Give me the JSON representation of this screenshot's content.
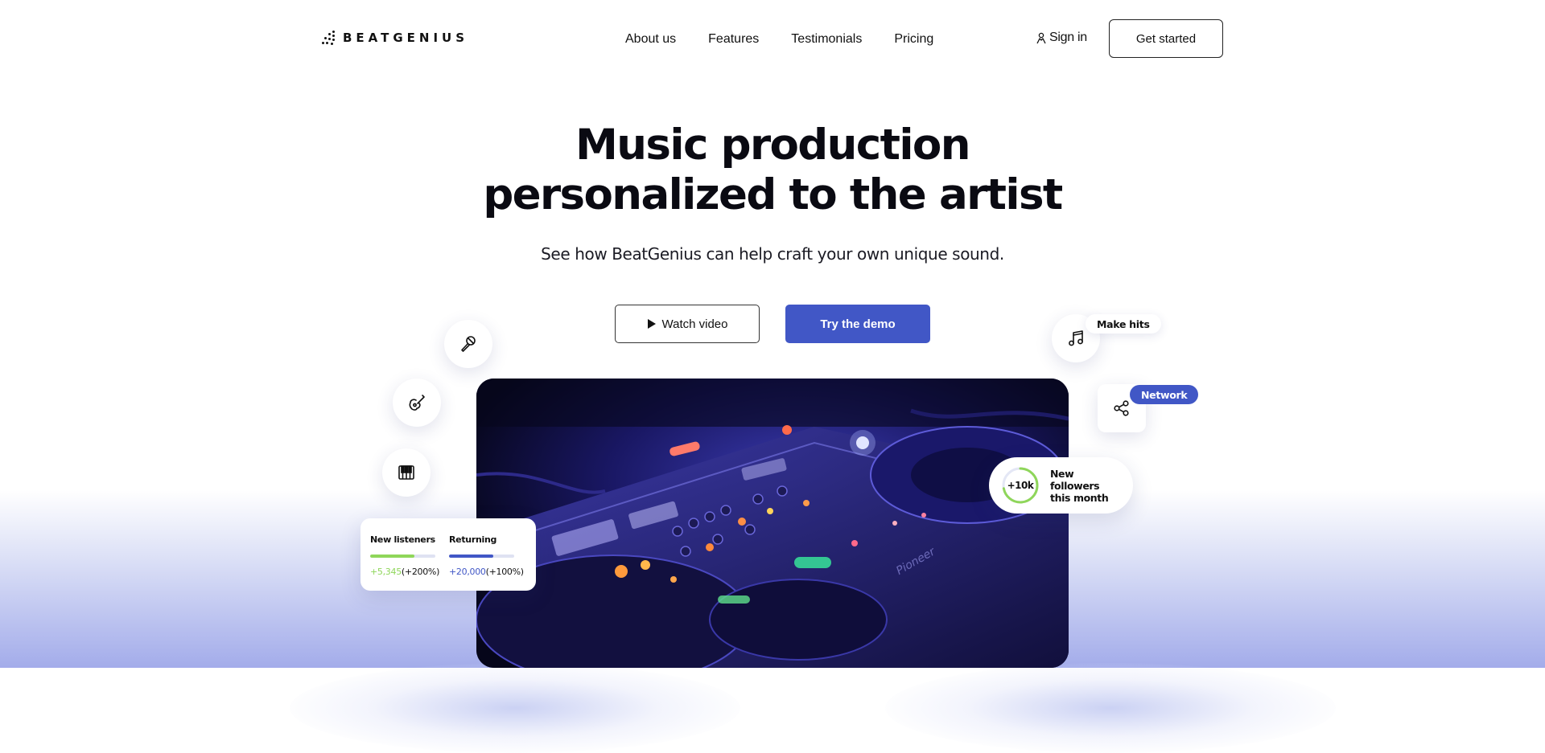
{
  "header": {
    "brand": "BEATGENIUS",
    "nav": [
      "About us",
      "Features",
      "Testimonials",
      "Pricing"
    ],
    "sign_in": "Sign in",
    "get_started": "Get started"
  },
  "hero": {
    "title_line1": "Music production",
    "title_line2": "personalized to the artist",
    "subtitle": "See how BeatGenius can help craft your own unique sound.",
    "watch_video": "Watch video",
    "try_demo": "Try the demo"
  },
  "floating": {
    "icons": [
      "microphone-icon",
      "guitar-icon",
      "piano-icon",
      "music-note-icon",
      "share-icon"
    ],
    "make_hits": "Make hits",
    "network": "Network",
    "followers": {
      "count": "+10k",
      "label": "New followers this month",
      "ring_progress": 0.72
    },
    "stats": [
      {
        "label": "New listeners",
        "value": "+5,345",
        "change": "(+200%)",
        "fill": 0.68,
        "color": "#8fd65a"
      },
      {
        "label": "Returning",
        "value": "+20,000",
        "change": "(+100%)",
        "fill": 0.68,
        "color": "#4157c6"
      }
    ]
  },
  "colors": {
    "accent": "#4157c6",
    "green": "#8fd65a",
    "band_bottom": "#a3acea"
  }
}
